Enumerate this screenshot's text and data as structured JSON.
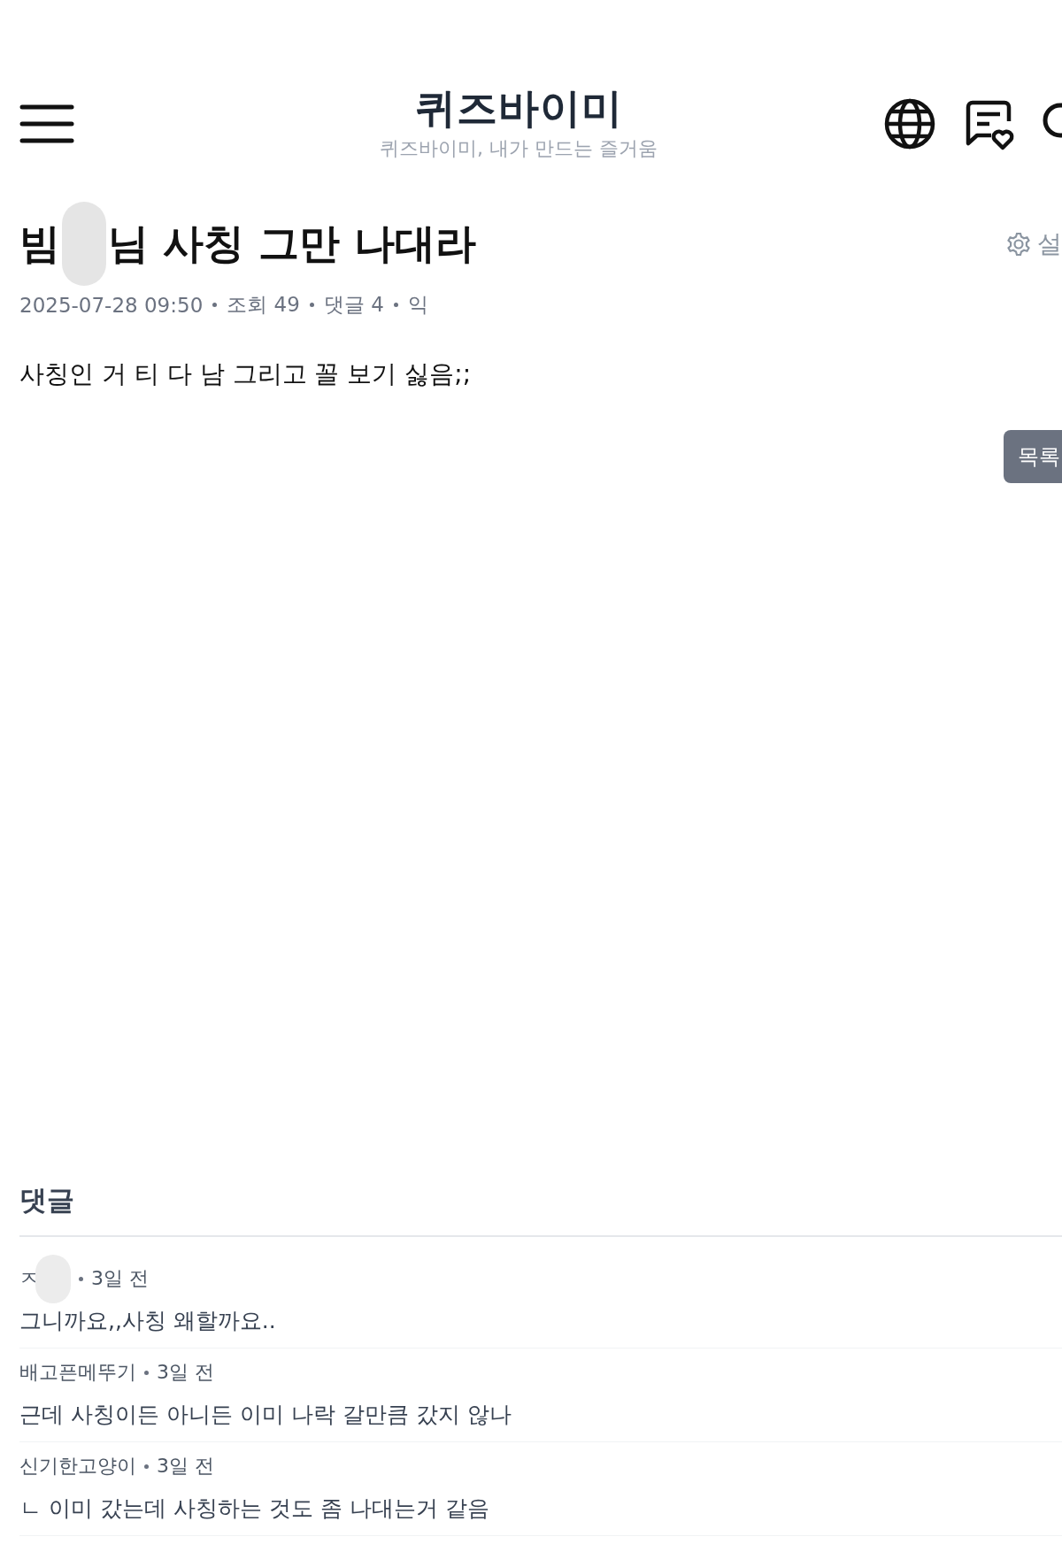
{
  "header": {
    "logo": "퀴즈바이미",
    "tagline": "퀴즈바이미, 내가 만드는 즐거움"
  },
  "post": {
    "title_start": "빔",
    "title_end": "님 사칭 그만 나대라",
    "settings": "설",
    "meta": [
      "2025-07-28 09:50",
      "조회 49",
      "댓글 4",
      "익"
    ],
    "body": "사칭인 거 티 다 남 그리고 꼴 보기 싫음;;",
    "list_button": "목록"
  },
  "comments": {
    "heading": "댓글",
    "items": [
      {
        "author": "ㅈ",
        "redacted": true,
        "time": "3일 전",
        "text": "그니까요,,사칭 왜할까요.."
      },
      {
        "author": "배고픈메뚜기",
        "redacted": false,
        "time": "3일 전",
        "text": "근데 사칭이든 아니든 이미 나락 갈만큼 갔지 않나"
      },
      {
        "author": "신기한고양이",
        "redacted": false,
        "time": "3일 전",
        "text": "ㄴ 이미 갔는데 사칭하는 것도 좀 나대는거 같음"
      }
    ]
  }
}
